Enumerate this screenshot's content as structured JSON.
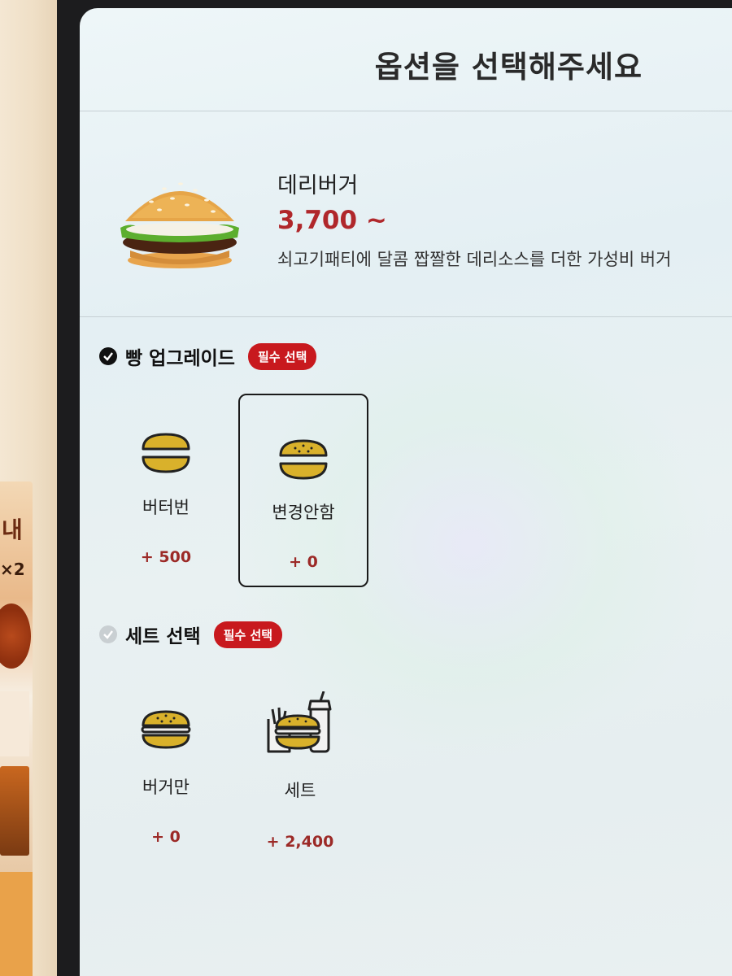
{
  "header": {
    "title": "옵션을 선택해주세요"
  },
  "product": {
    "name": "데리버거",
    "price": "3,700 ~",
    "description": "쇠고기패티에 달콤 짭짤한 데리소스를 더한 가성비 버거"
  },
  "bread_section": {
    "title": "빵 업그레이드",
    "badge": "필수 선택",
    "checked": true,
    "options": [
      {
        "label": "버터번",
        "price": "+ 500",
        "selected": false,
        "icon": "bun-icon"
      },
      {
        "label": "변경안함",
        "price": "+ 0",
        "selected": true,
        "icon": "sesame-bun-icon"
      }
    ]
  },
  "set_section": {
    "title": "세트 선택",
    "badge": "필수 선택",
    "checked": false,
    "options": [
      {
        "label": "버거만",
        "price": "+ 0",
        "selected": false,
        "icon": "burger-icon"
      },
      {
        "label": "세트",
        "price": "+ 2,400",
        "selected": false,
        "icon": "set-meal-icon"
      }
    ]
  },
  "colors": {
    "accent_red": "#c8191e",
    "price_red": "#b0272b",
    "bun_yellow": "#e2b929"
  },
  "poster": {
    "text_1": "내",
    "text_2": "×2"
  }
}
